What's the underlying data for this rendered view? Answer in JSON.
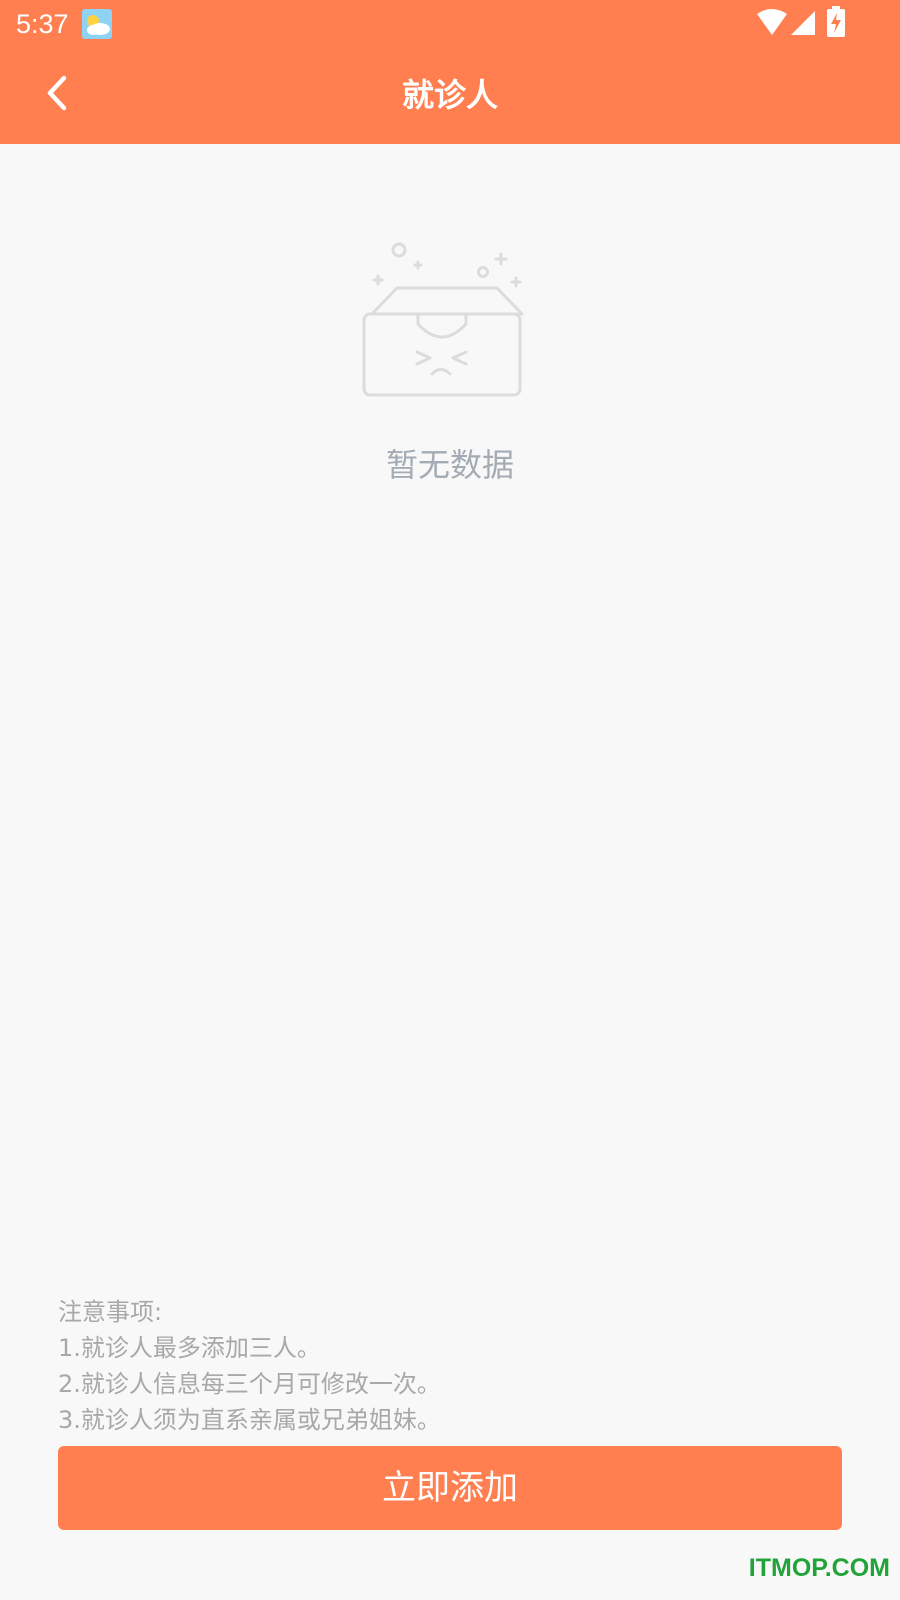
{
  "status_bar": {
    "time": "5:37",
    "icons": [
      "weather-icon",
      "wifi-icon",
      "signal-icon",
      "battery-charging-icon"
    ]
  },
  "header": {
    "title": "就诊人",
    "back_icon": "chevron-left-icon",
    "background_color": "#ff7f50"
  },
  "empty_state": {
    "icon": "empty-box-icon",
    "text": "暂无数据"
  },
  "notice": {
    "heading": "注意事项:",
    "items": [
      "1.就诊人最多添加三人。",
      "2.就诊人信息每三个月可修改一次。",
      "3.就诊人须为直系亲属或兄弟姐妹。"
    ]
  },
  "actions": {
    "add_label": "立即添加",
    "accent_color": "#ff7f50"
  },
  "watermark": {
    "text": "ITMOP.COM"
  }
}
